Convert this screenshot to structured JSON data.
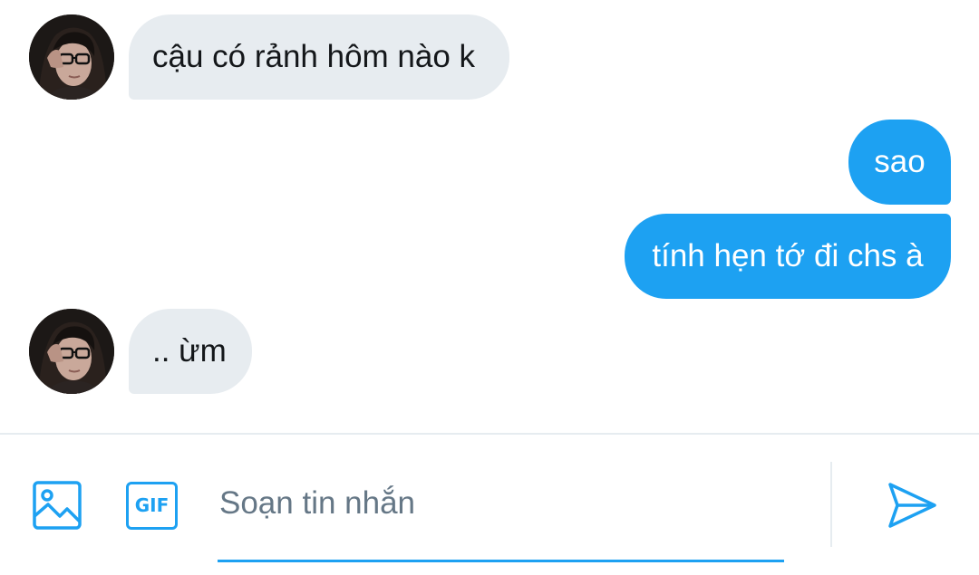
{
  "messages": [
    {
      "direction": "incoming",
      "text": "cậu có rảnh hôm nào k"
    },
    {
      "direction": "outgoing",
      "text": "sao"
    },
    {
      "direction": "outgoing",
      "text": "tính hẹn tớ đi chs à"
    },
    {
      "direction": "incoming",
      "text": ".. ừm"
    }
  ],
  "composer": {
    "placeholder": "Soạn tin nhắn",
    "value": "",
    "gif_label": "GIF",
    "icons": {
      "media": "image-icon",
      "gif": "gif-icon",
      "send": "send-icon"
    }
  },
  "colors": {
    "accent": "#1da1f2",
    "incoming_bubble": "#e7ecf0",
    "outgoing_bubble": "#1da1f2",
    "placeholder": "#657786"
  }
}
